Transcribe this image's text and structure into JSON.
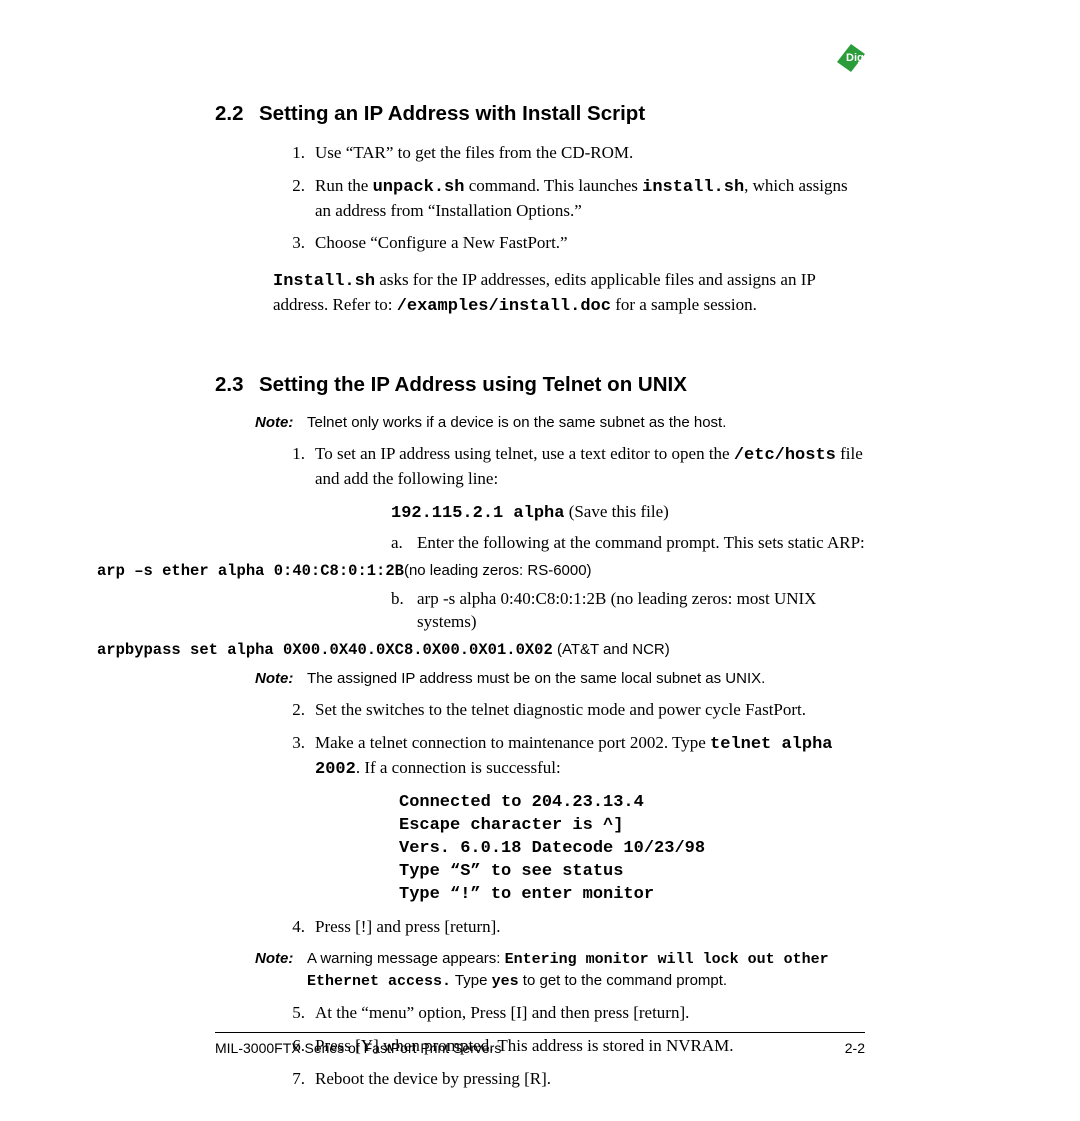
{
  "logo_text": "Digi",
  "sections": {
    "s22": {
      "num": "2.2",
      "title": "Setting an IP Address with Install Script"
    },
    "s23": {
      "num": "2.3",
      "title": "Setting the IP Address using Telnet on UNIX"
    }
  },
  "s22_items": {
    "i1": {
      "idx": "1.",
      "text_a": "Use “TAR” to get the files from the CD-ROM."
    },
    "i2": {
      "idx": "2.",
      "a": "Run the ",
      "b": "unpack.sh",
      "c": " command. This launches ",
      "d": "install.sh",
      "e": ", which assigns an address from “Installation Options.”"
    },
    "i3": {
      "idx": "3.",
      "text_a": "Choose “Configure a New FastPort.”"
    }
  },
  "s22_para": {
    "a": "Install.sh",
    "b": " asks for the IP addresses, edits applicable files and assigns an IP address. Refer to: ",
    "c": "/examples/install.doc",
    "d": " for a sample session."
  },
  "s23_note1": {
    "label": "Note:",
    "body": "Telnet only works if a device is on the same subnet as the host."
  },
  "s23_item1": {
    "idx": "1.",
    "a": "To set an IP address using telnet, use a text editor to open the ",
    "b": "/etc/hosts",
    "c": " file and add the following line:"
  },
  "s23_codeline": {
    "a": "192.115.2.1 alpha",
    "b": " (Save this file)"
  },
  "s23_sub_a": {
    "idx": "a.",
    "text": "Enter the following at the command prompt. This sets static ARP:"
  },
  "s23_arp1": {
    "a": "arp –s ether alpha 0:40:C8:0:1:2B",
    "b": "(no leading zeros: RS-6000)"
  },
  "s23_sub_b": {
    "idx": "b.",
    "text": "arp -s alpha 0:40:C8:0:1:2B (no leading zeros: most UNIX systems)"
  },
  "s23_arp2": {
    "a": "arpbypass set alpha 0X00.0X40.0XC8.0X00.0X01.0X02",
    "b": " (AT&T and NCR)"
  },
  "s23_note2": {
    "label": "Note:",
    "body": "The assigned IP address must be on the same local subnet as UNIX."
  },
  "s23_item2": {
    "idx": "2.",
    "text": "Set the switches to the telnet diagnostic mode and power cycle FastPort."
  },
  "s23_item3": {
    "idx": "3.",
    "a": "Make a telnet connection to maintenance port 2002. Type ",
    "b": "telnet alpha 2002",
    "c": ". If a connection is successful:"
  },
  "telnet": {
    "l1": "Connected to 204.23.13.4",
    "l2": "Escape character is ^]",
    "l3": "Vers. 6.0.18 Datecode 10/23/98",
    "l4": "Type “S” to see status",
    "l5": "Type “!” to enter monitor"
  },
  "s23_item4": {
    "idx": "4.",
    "text": "Press [!] and press [return]."
  },
  "s23_note3": {
    "label": "Note:",
    "a": "A warning message appears: ",
    "b": "Entering monitor will lock out other Ethernet access.",
    "c": " Type ",
    "d": "yes",
    "e": " to get to the command prompt."
  },
  "s23_item5": {
    "idx": "5.",
    "text": "At the “menu” option, Press [I] and then press [return]."
  },
  "s23_item6": {
    "idx": "6.",
    "text": "Press [Y] when prompted. This address is stored in NVRAM."
  },
  "s23_item7": {
    "idx": "7.",
    "text": "Reboot the device by pressing [R]."
  },
  "footer": {
    "left": "MIL-3000FTX Series of FastPort Print Servers",
    "right": "2-2"
  }
}
